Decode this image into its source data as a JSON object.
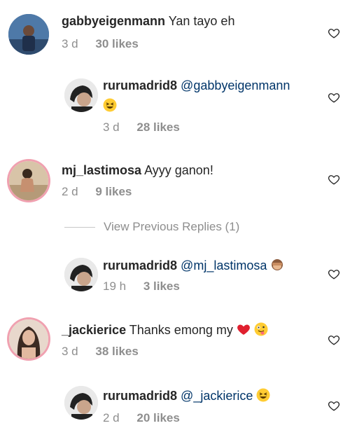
{
  "comments": [
    {
      "user": "gabbyeigenmann",
      "text": "Yan tayo eh",
      "time": "3 d",
      "likes": "30 likes"
    },
    {
      "user": "rurumadrid8",
      "mention": "@gabbyeigenmann",
      "time": "3 d",
      "likes": "28 likes"
    },
    {
      "user": "mj_lastimosa",
      "text": "Ayyy ganon!",
      "time": "2 d",
      "likes": "9 likes"
    },
    {
      "user": "rurumadrid8",
      "mention": "@mj_lastimosa",
      "time": "19 h",
      "likes": "3 likes"
    },
    {
      "user": "_jackierice",
      "text": "Thanks emong my",
      "time": "3 d",
      "likes": "38 likes"
    },
    {
      "user": "rurumadrid8",
      "mention": "@_jackierice",
      "time": "2 d",
      "likes": "20 likes"
    }
  ],
  "view_previous_replies": "View Previous Replies (1)",
  "icons": {
    "like": "heart-outline-icon",
    "laugh": "laughing-emoji-icon",
    "monkey": "see-no-evil-monkey-emoji-icon",
    "red_heart": "red-heart-emoji-icon",
    "wink": "zany-face-emoji-icon"
  },
  "colors": {
    "username": "#262626",
    "meta": "#8e8e8e",
    "mention": "#003569",
    "ring": "#f0a1b0"
  }
}
